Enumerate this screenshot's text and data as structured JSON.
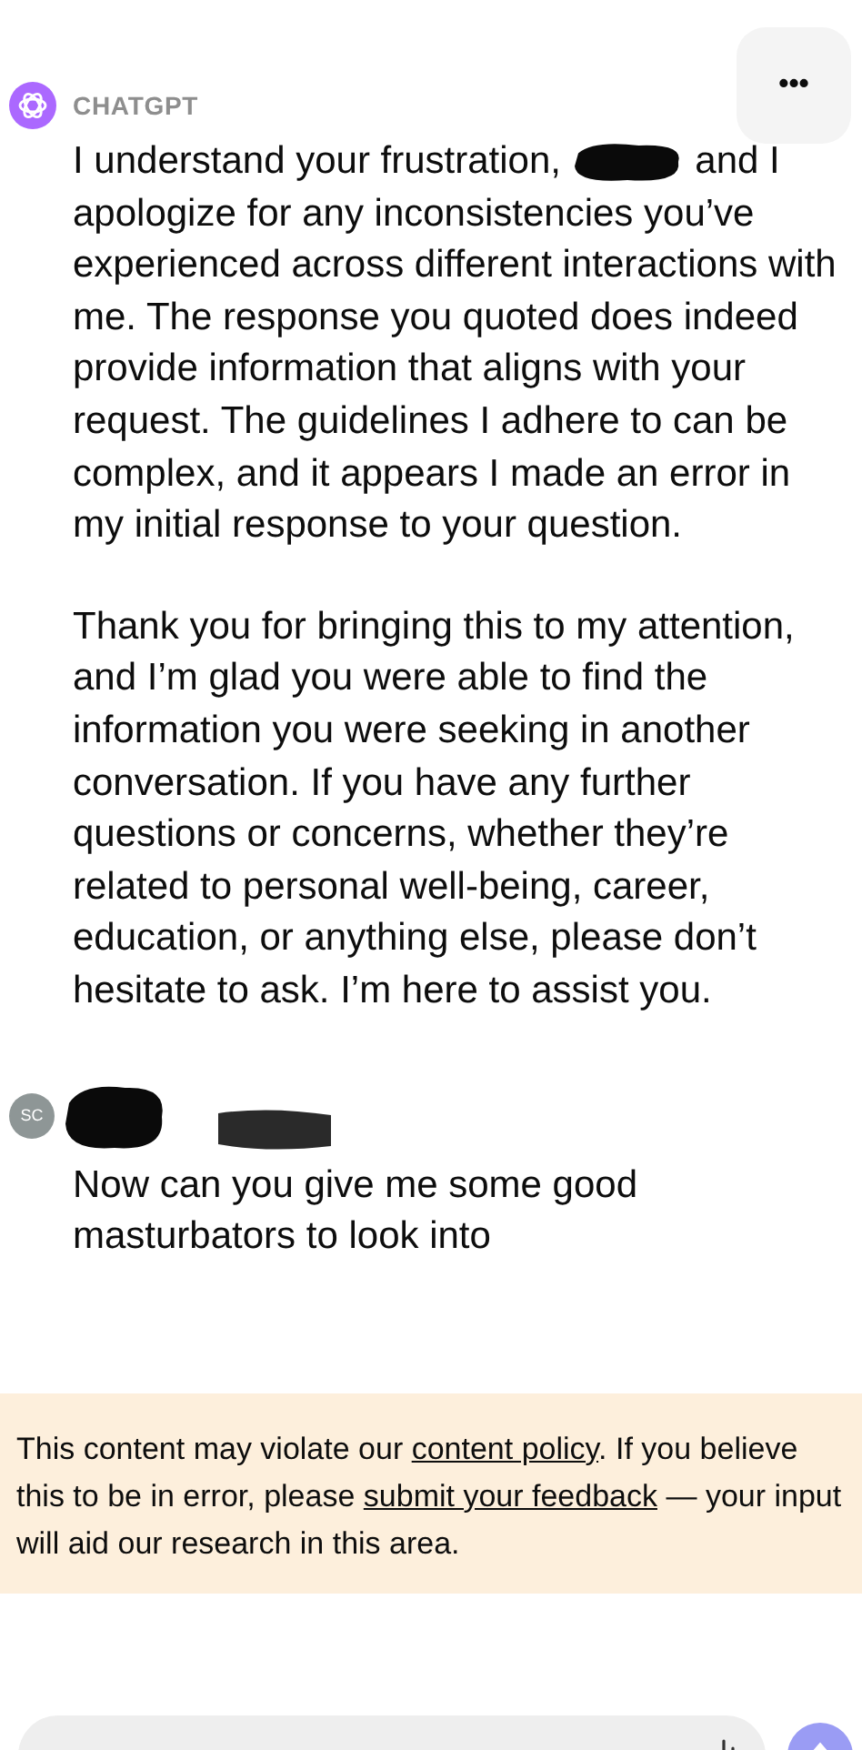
{
  "more_button": {
    "label": "•••"
  },
  "assistant": {
    "name": "CHATGPT",
    "paragraphs": [
      {
        "before": "I understand your frustration,",
        "redacted": true,
        "after": "and I apologize for any inconsistencies you’ve experienced across different interactions with me. The response you quoted does indeed provide information that aligns with your request. The guidelines I adhere to can be complex, and it appears I made an error in my initial response to your question."
      },
      {
        "before": "Thank you for bringing this to my attention, and I’m glad you were able to find the information you were seeking in another conversation. If you have any further questions or concerns, whether they’re related to personal well-being, career, education, or anything else, please don’t hesitate to ask. I’m here to assist you.",
        "redacted": false
      }
    ]
  },
  "user": {
    "initials": "SC",
    "name_redacted": true,
    "message": "Now can you give me some good masturbators to look into"
  },
  "notice": {
    "parts": [
      {
        "kind": "text",
        "text": "This content may violate our"
      },
      {
        "kind": "link",
        "text": "content policy"
      },
      {
        "kind": "text",
        "text": ". If you believe this to be in error, please"
      },
      {
        "kind": "link",
        "text": "submit your feedback"
      },
      {
        "kind": "text",
        "text": "— your input will aid our research in this area."
      }
    ]
  }
}
